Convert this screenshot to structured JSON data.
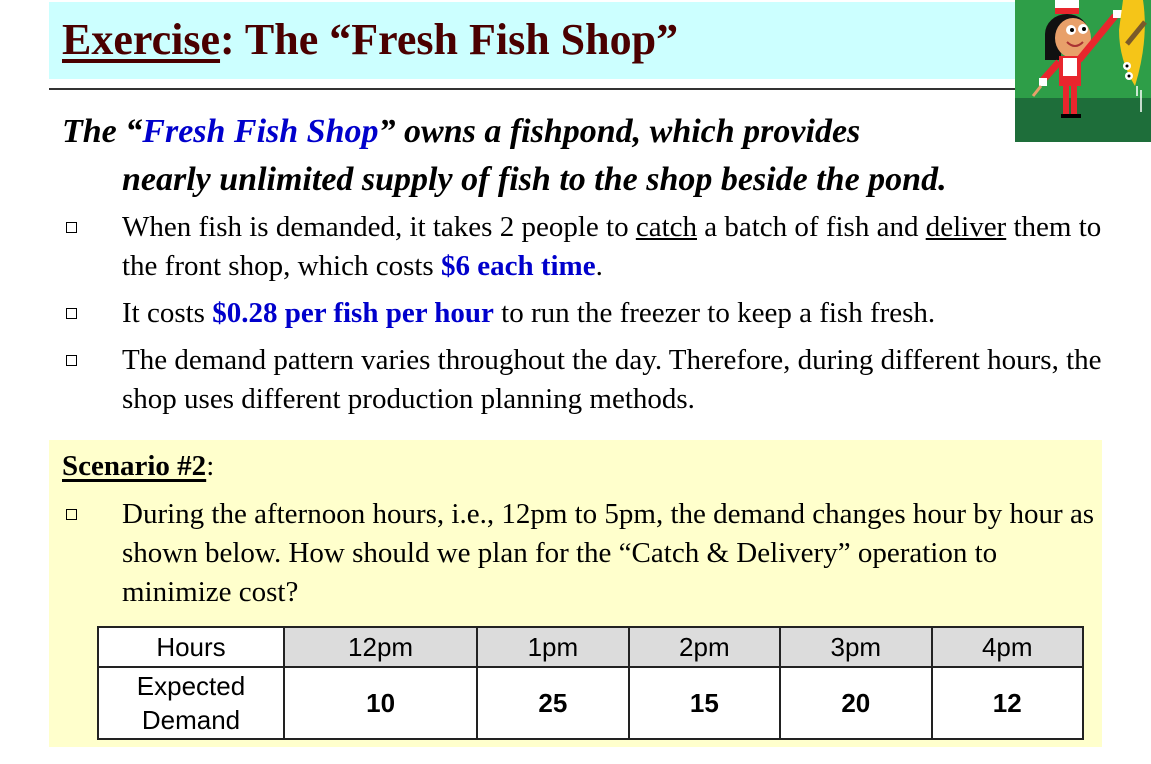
{
  "title": {
    "prefix": "Exercise",
    "suffix": ": The “Fresh Fish Shop”"
  },
  "clipart": {
    "icon": "chef-holding-fish-illustration",
    "colors": {
      "background": "#2e9e48",
      "ground": "#1e6e3a",
      "uniform": "#e8262d",
      "fish": "#f5c518"
    }
  },
  "intro": {
    "part1": "The “",
    "highlight": "Fresh Fish Shop",
    "part2": "” owns a fishpond, which provides",
    "line2": "nearly unlimited supply of fish to the shop beside the pond."
  },
  "bullets": [
    {
      "t1": "When fish is demanded, it takes 2 people to ",
      "u1": "catch",
      "t2": " a batch of fish and ",
      "u2": "deliver",
      "t3": " them to the front shop, which costs ",
      "highlight": "$6 each time",
      "t4": "."
    },
    {
      "t1": "It costs ",
      "highlight": "$0.28 per fish per hour",
      "t2": " to run the freezer to keep a fish fresh."
    },
    {
      "text": "The demand pattern varies throughout the day. Therefore, during different hours, the shop uses different production planning methods."
    }
  ],
  "scenario": {
    "title": "Scenario #2",
    "colon": ":",
    "bullet": "During the afternoon hours, i.e., 12pm to 5pm, the demand changes hour by hour as shown below. How should we plan for the “Catch & Delivery” operation to minimize cost?"
  },
  "table": {
    "header_label": "Hours",
    "row_label_line1": "Expected",
    "row_label_line2": "Demand",
    "hours": [
      "12pm",
      "1pm",
      "2pm",
      "3pm",
      "4pm"
    ],
    "demand": [
      "10",
      "25",
      "15",
      "20",
      "12"
    ]
  },
  "colors": {
    "title_text": "#4a0000",
    "title_band": "#ccffff",
    "highlight_blue": "#0000cc",
    "scenario_panel": "#ffffcc",
    "table_header": "#dcdcdc"
  }
}
